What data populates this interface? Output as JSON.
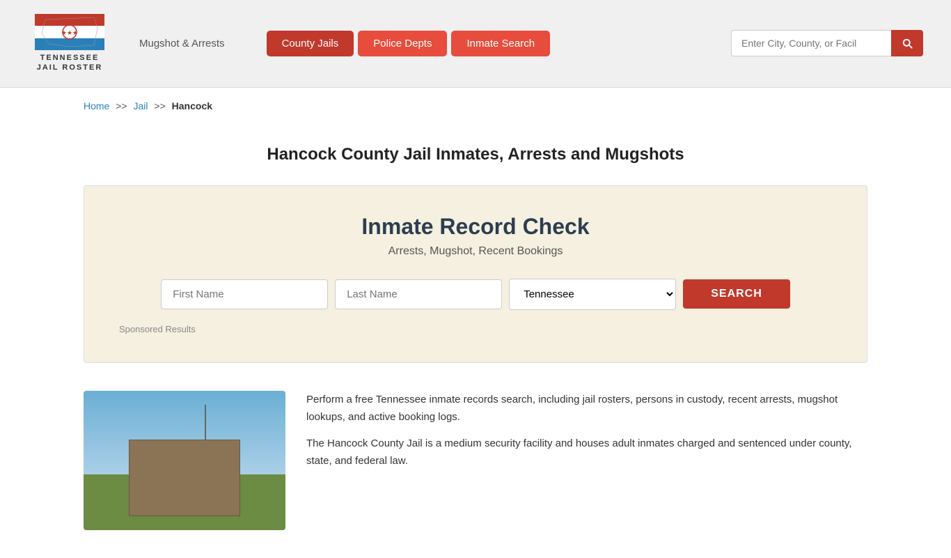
{
  "header": {
    "logo_line1": "TENNESSEE",
    "logo_line2": "JAIL ROSTER",
    "mugshot_link": "Mugshot & Arrests",
    "nav": {
      "county_jails": "County Jails",
      "police_depts": "Police Depts",
      "inmate_search": "Inmate Search"
    },
    "search_placeholder": "Enter City, County, or Facil"
  },
  "breadcrumb": {
    "home": "Home",
    "sep1": ">>",
    "jail": "Jail",
    "sep2": ">>",
    "current": "Hancock"
  },
  "page": {
    "title": "Hancock County Jail Inmates, Arrests and Mugshots"
  },
  "inmate_check": {
    "title": "Inmate Record Check",
    "subtitle": "Arrests, Mugshot, Recent Bookings",
    "first_name_placeholder": "First Name",
    "last_name_placeholder": "Last Name",
    "state_default": "Tennessee",
    "search_button": "SEARCH",
    "sponsored": "Sponsored Results"
  },
  "description": {
    "para1": "Perform a free Tennessee inmate records search, including jail rosters, persons in custody, recent arrests, mugshot lookups, and active booking logs.",
    "para2": "The Hancock County Jail is a medium security facility and houses adult inmates charged and sentenced under county, state, and federal law."
  }
}
